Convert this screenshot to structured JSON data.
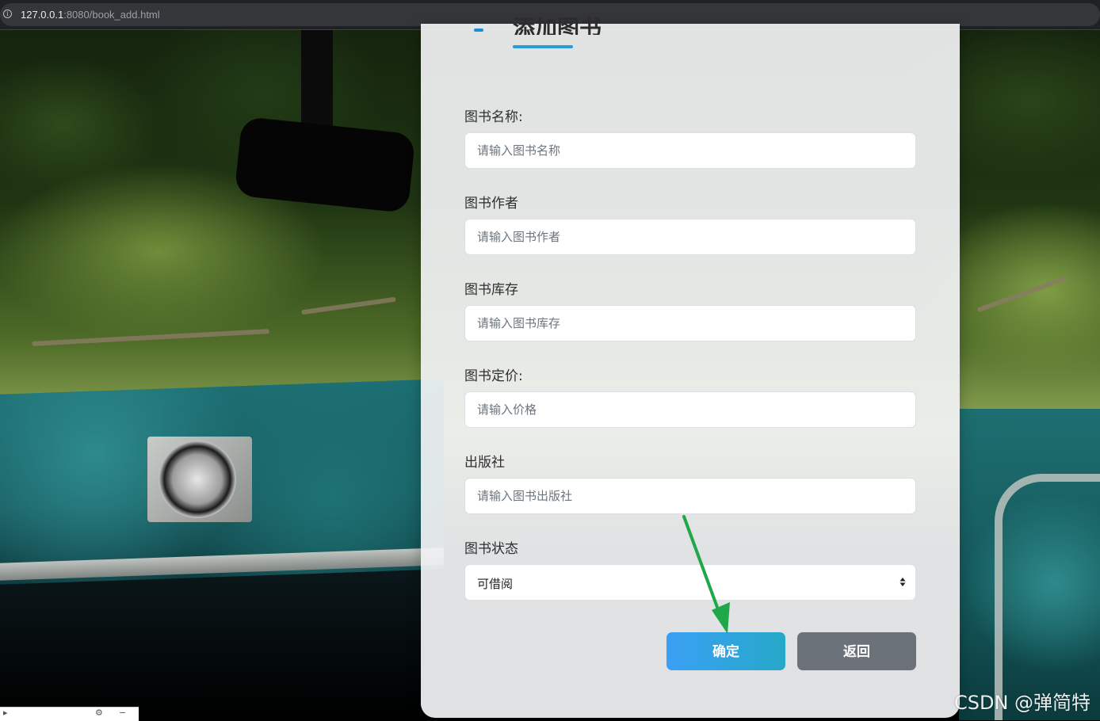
{
  "browser": {
    "url_host": "127.0.0.1",
    "url_rest": ":8080/book_add.html"
  },
  "form": {
    "title": "添加图书",
    "fields": [
      {
        "label": "图书名称:",
        "placeholder": "请输入图书名称"
      },
      {
        "label": "图书作者",
        "placeholder": "请输入图书作者"
      },
      {
        "label": "图书库存",
        "placeholder": "请输入图书库存"
      },
      {
        "label": "图书定价:",
        "placeholder": "请输入价格"
      },
      {
        "label": "出版社",
        "placeholder": "请输入图书出版社"
      }
    ],
    "status": {
      "label": "图书状态",
      "selected": "可借阅"
    },
    "buttons": {
      "confirm": "确定",
      "back": "返回"
    }
  },
  "watermark": "CSDN @弹简特",
  "colors": {
    "confirm_button": "#3aa0f5",
    "back_button": "#6c727a",
    "title_underline": "#2a9bd9",
    "annotation_arrow": "#1fa84a"
  }
}
